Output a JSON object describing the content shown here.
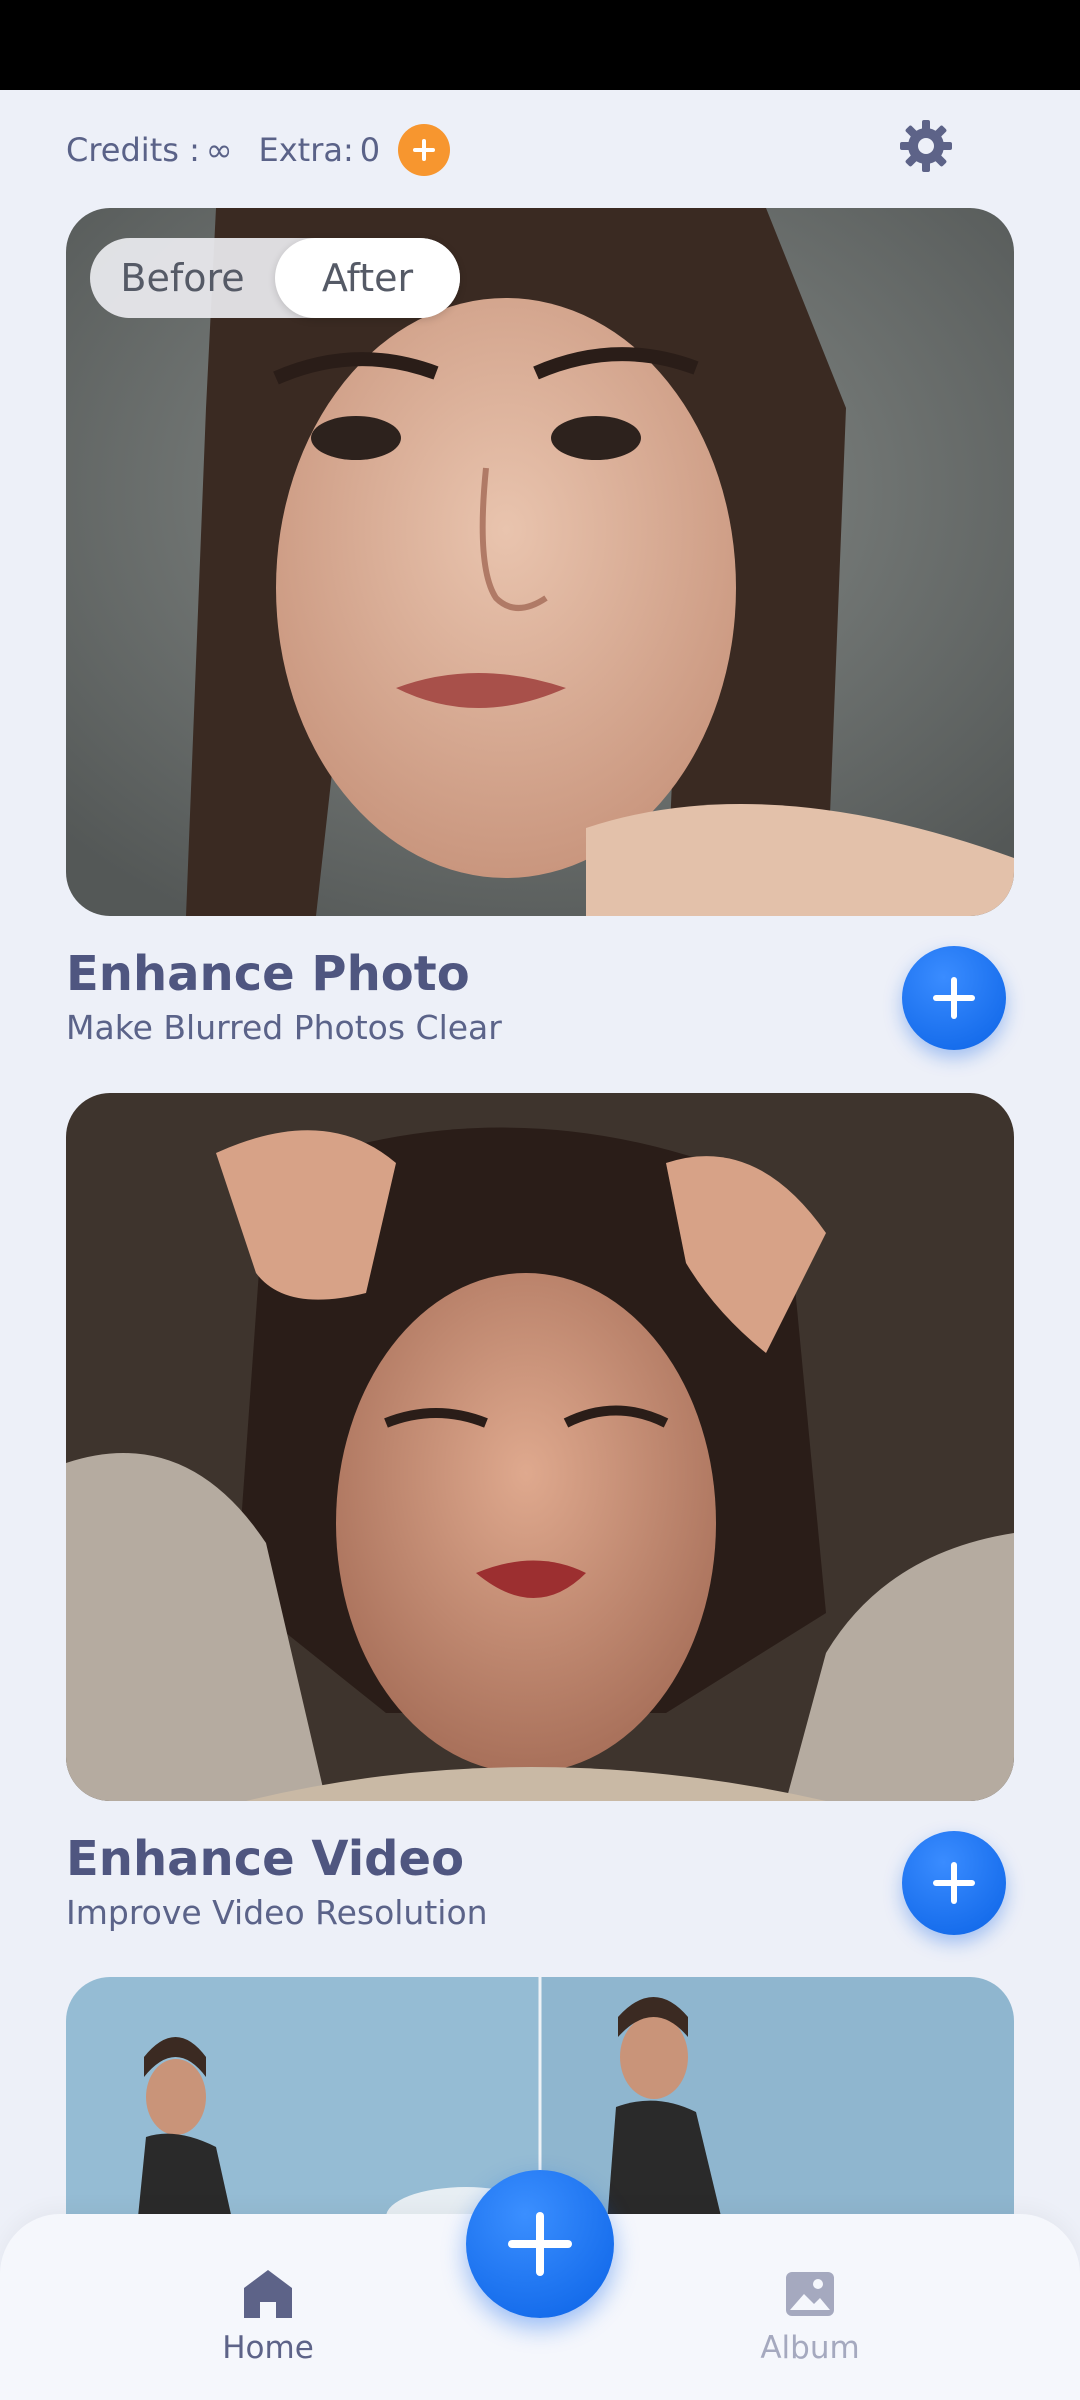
{
  "header": {
    "credits_label": "Credits :",
    "credits_value": "∞",
    "extra_label": "Extra:",
    "extra_value": "0"
  },
  "photo_card": {
    "toggle": {
      "before": "Before",
      "after": "After",
      "selected": "After"
    },
    "title": "Enhance Photo",
    "subtitle": "Make Blurred Photos Clear"
  },
  "video_card": {
    "title": "Enhance Video",
    "subtitle": "Improve Video Resolution"
  },
  "bottom_nav": {
    "home": "Home",
    "album": "Album"
  },
  "icons": {
    "add_credit": "plus-circle-icon",
    "settings": "gear-icon",
    "home": "home-icon",
    "album": "image-icon",
    "add": "plus-icon"
  },
  "colors": {
    "accent_blue": "#0b63e6",
    "accent_orange": "#f7962f",
    "background": "#edf0f8",
    "text": "#4f5680"
  }
}
